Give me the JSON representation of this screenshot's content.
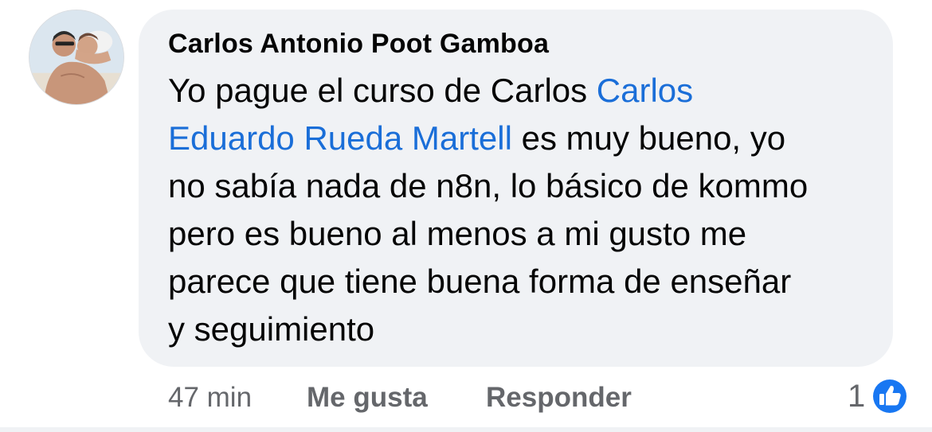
{
  "comment": {
    "author": "Carlos Antonio Poot Gamboa",
    "text_lines": [
      {
        "before": "Yo pague el curso de Carlos ",
        "mention": "Carlos",
        "after": ""
      },
      {
        "before": "",
        "mention": "Eduardo Rueda Martell",
        "after": " es muy bueno, yo"
      },
      {
        "before": "no sabía nada de n8n, lo básico de kommo",
        "mention": "",
        "after": ""
      },
      {
        "before": "pero es bueno al menos a mi gusto me",
        "mention": "",
        "after": ""
      },
      {
        "before": "parece que tiene buena forma de enseñar",
        "mention": "",
        "after": ""
      },
      {
        "before": "y seguimiento",
        "mention": "",
        "after": ""
      }
    ],
    "mention_color": "#1a6ed8"
  },
  "actions": {
    "timestamp": "47 min",
    "like_label": "Me gusta",
    "reply_label": "Responder"
  },
  "reaction": {
    "count": "1",
    "icon": "thumbs-up-icon",
    "color": "#1877f2"
  },
  "colors": {
    "bubble": "#f0f2f5",
    "text": "#050505",
    "secondary": "#65676b"
  }
}
